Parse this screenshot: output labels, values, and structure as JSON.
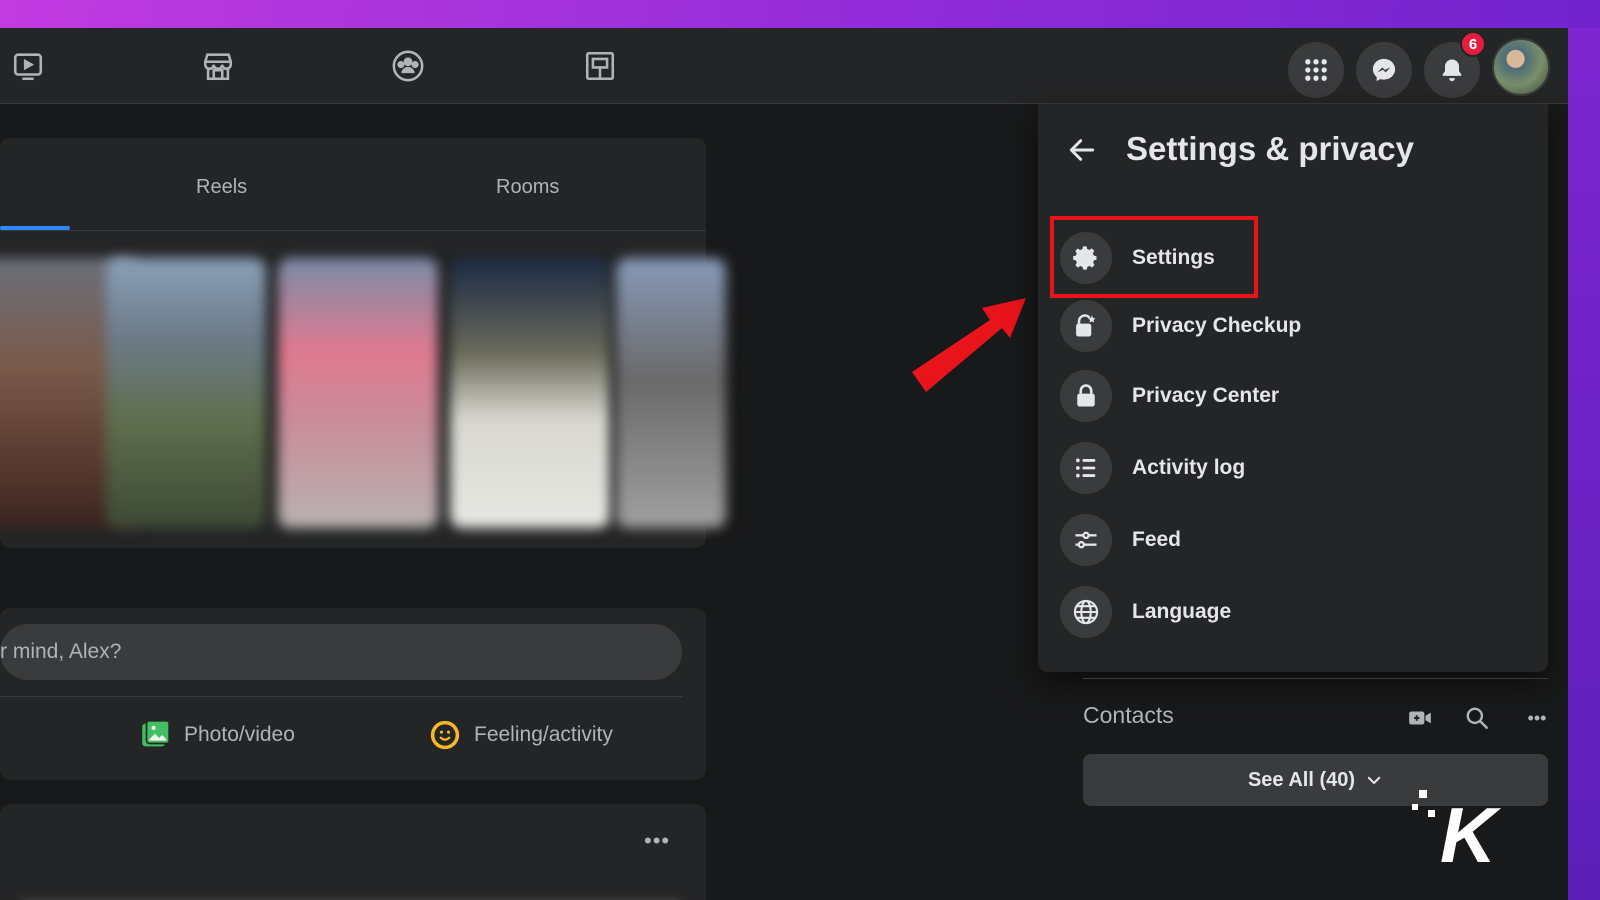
{
  "nav": {
    "icons": [
      "video-icon",
      "marketplace-icon",
      "groups-icon",
      "gaming-icon"
    ],
    "notification_count": "6"
  },
  "feed": {
    "tabs": [
      "Reels",
      "Rooms"
    ],
    "composer_placeholder": "r mind, Alex?",
    "actions": {
      "photo_video": "Photo/video",
      "feeling_activity": "Feeling/activity"
    },
    "post_more": "•••"
  },
  "panel": {
    "title": "Settings & privacy",
    "items": [
      {
        "label": "Settings",
        "icon": "gear-icon"
      },
      {
        "label": "Privacy Checkup",
        "icon": "lock-check-icon"
      },
      {
        "label": "Privacy Center",
        "icon": "lock-icon"
      },
      {
        "label": "Activity log",
        "icon": "list-icon"
      },
      {
        "label": "Feed",
        "icon": "sliders-icon"
      },
      {
        "label": "Language",
        "icon": "globe-icon"
      }
    ]
  },
  "contacts": {
    "title": "Contacts",
    "see_all": "See All (40)",
    "more": "•••"
  },
  "watermark": "K",
  "colors": {
    "background": "#18191a",
    "surface": "#242526",
    "surface_alt": "#3a3b3c",
    "accent": "#2d88ff",
    "highlight": "#e8141c",
    "badge": "#e41e3f"
  }
}
